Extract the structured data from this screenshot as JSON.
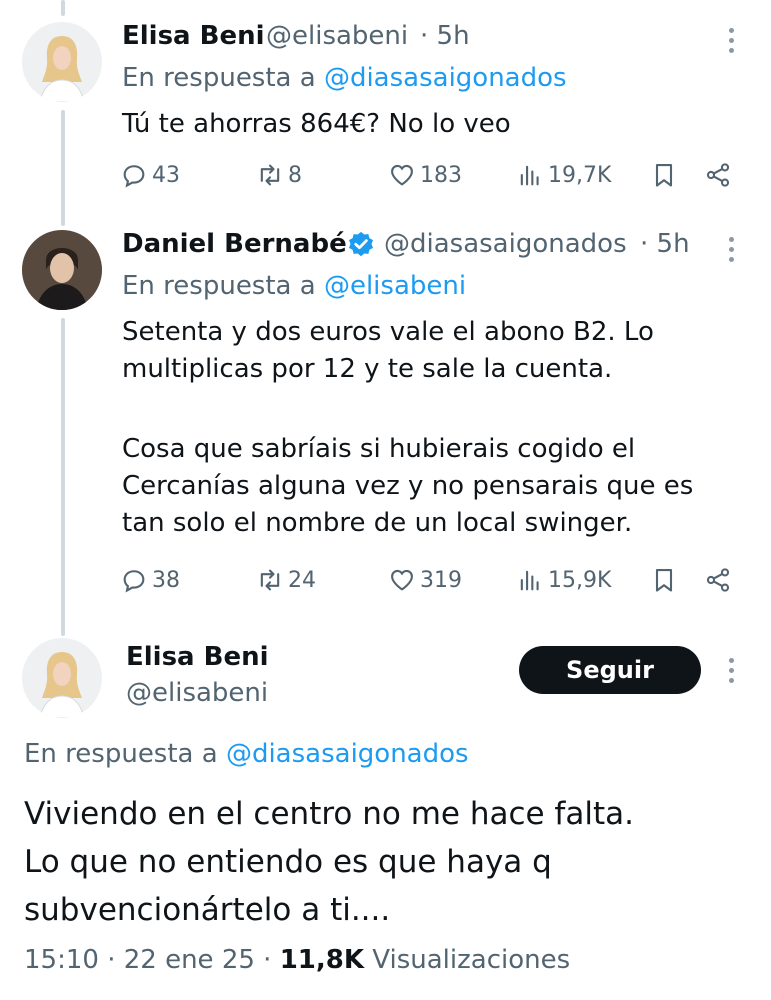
{
  "tweets": [
    {
      "name": "Elisa Beni",
      "handle": "@elisabeni",
      "time": "· 5h",
      "reply_prefix": "En respuesta a ",
      "reply_to": "@diasasaigonados",
      "text": "Tú te ahorras 864€? No lo veo",
      "replies": "43",
      "retweets": "8",
      "likes": "183",
      "views": "19,7K"
    },
    {
      "name": "Daniel Bernabé",
      "verified": true,
      "handle": "@diasasaigonados",
      "time": "· 5h",
      "reply_prefix": "En respuesta a ",
      "reply_to": "@elisabeni",
      "text_p1": "Setenta y dos euros vale el abono B2. Lo multiplicas por 12 y te sale la cuenta.",
      "text_p2": "Cosa que sabríais si hubierais cogido el Cercanías alguna vez y no pensarais que es tan solo el nombre de un local swinger.",
      "replies": "38",
      "retweets": "24",
      "likes": "319",
      "views": "15,9K"
    }
  ],
  "main_tweet": {
    "name": "Elisa Beni",
    "handle": "@elisabeni",
    "follow_label": "Seguir",
    "reply_prefix": "En respuesta a ",
    "reply_to": "@diasasaigonados",
    "text": "Viviendo en el centro no me hace falta. Lo que no entiendo es que haya q subvencionártelo a ti....",
    "time": "15:10",
    "date": "22 ene 25",
    "views_count": "11,8K",
    "views_label": "Visualizaciones"
  },
  "colors": {
    "accent": "#1d9bf0",
    "text": "#0f1419",
    "secondary": "#536471",
    "follow_button": "#0f1419"
  }
}
